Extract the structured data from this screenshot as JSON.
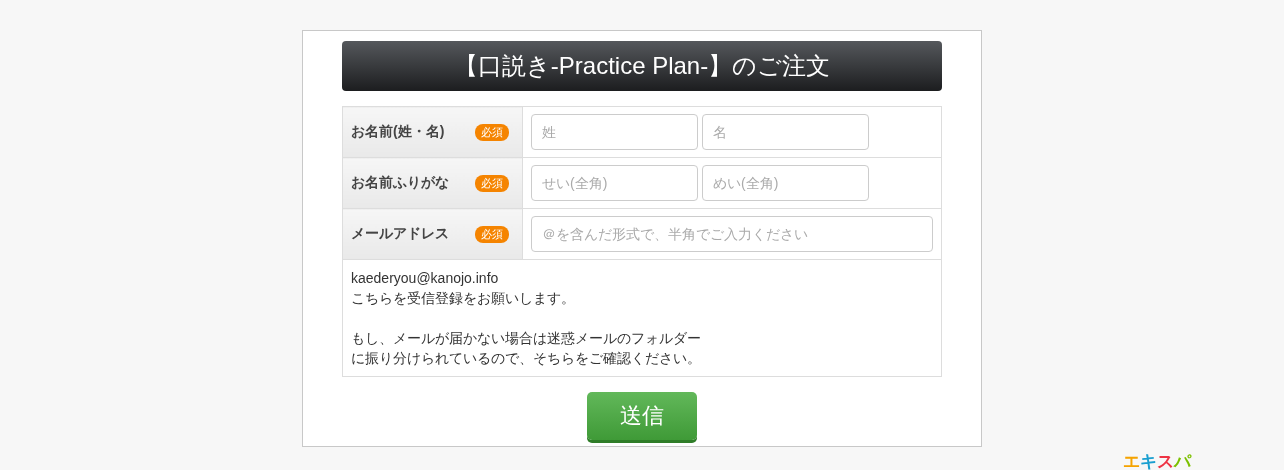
{
  "title": "【口説き-Practice Plan-】のご注文",
  "fields": [
    {
      "label": "お名前(姓・名)",
      "badge": "必須",
      "inputs": [
        {
          "placeholder": "姓"
        },
        {
          "placeholder": "名"
        }
      ]
    },
    {
      "label": "お名前ふりがな",
      "badge": "必須",
      "inputs": [
        {
          "placeholder": "せい(全角)"
        },
        {
          "placeholder": "めい(全角)"
        }
      ]
    },
    {
      "label": "メールアドレス",
      "badge": "必須",
      "inputs": [
        {
          "placeholder": "＠を含んだ形式で、半角でご入力ください"
        }
      ]
    }
  ],
  "note": [
    {
      "lines": [
        "kaederyou@kanojo.info",
        "こちらを受信登録をお願いします。"
      ]
    },
    {
      "lines": [
        "もし、メールが届かない場合は迷惑メールのフォルダー",
        "に振り分けられているので、そちらをご確認ください。"
      ]
    }
  ],
  "submit": "送信",
  "logo": [
    {
      "text": "エ",
      "color": "#f5a300"
    },
    {
      "text": "キ",
      "color": "#1a9fd0"
    },
    {
      "text": "ス",
      "color": "#ee3344"
    },
    {
      "text": "パ",
      "color": "#7cc000"
    }
  ]
}
